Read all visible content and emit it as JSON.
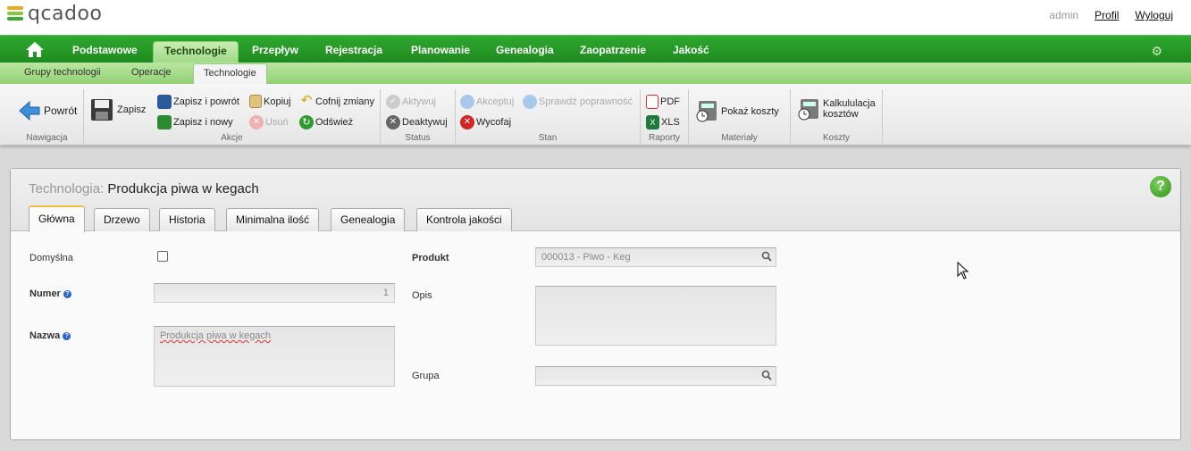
{
  "header": {
    "logo_text": "qcadoo",
    "user": "admin",
    "profile_link": "Profil",
    "logout_link": "Wyloguj"
  },
  "main_nav": [
    "Podstawowe",
    "Technologie",
    "Przepływ",
    "Rejestracja",
    "Planowanie",
    "Genealogia",
    "Zaopatrzenie",
    "Jakość"
  ],
  "sub_nav": [
    "Grupy technologii",
    "Operacje",
    "Technologie"
  ],
  "ribbon": {
    "groups": [
      "Nawigacja",
      "Akcje",
      "Status",
      "Stan",
      "Raporty",
      "Materiały",
      "Koszty"
    ],
    "back": "Powrót",
    "save": "Zapisz",
    "save_back": "Zapisz i powrót",
    "save_new": "Zapisz i nowy",
    "copy": "Kopiuj",
    "delete": "Usuń",
    "undo": "Cofnij zmiany",
    "refresh": "Odśwież",
    "activate": "Aktywuj",
    "deactivate": "Deaktywuj",
    "accept": "Akceptuj",
    "check": "Sprawdź poprawność",
    "withdraw": "Wycofaj",
    "pdf": "PDF",
    "xls": "XLS",
    "show_costs": "Pokaż koszty",
    "cost_calc_line1": "Kalkululacja",
    "cost_calc_line2": "kosztów"
  },
  "panel": {
    "title_label": "Technologia:",
    "title_value": "Produkcja piwa w kegach",
    "tabs": [
      "Główna",
      "Drzewo",
      "Historia",
      "Minimalna ilość",
      "Genealogia",
      "Kontrola jakości"
    ]
  },
  "form": {
    "default_label": "Domyślna",
    "number_label": "Numer",
    "number_value": "1",
    "name_label": "Nazwa",
    "name_value": "Produkcja piwa w kegach",
    "product_label": "Produkt",
    "product_value": "000013 - Piwo - Keg",
    "desc_label": "Opis",
    "group_label": "Grupa",
    "help_glyph": "?"
  },
  "colors": {
    "nav_green": "#1f8a1f",
    "active_tab_accent": "#f0c040"
  }
}
